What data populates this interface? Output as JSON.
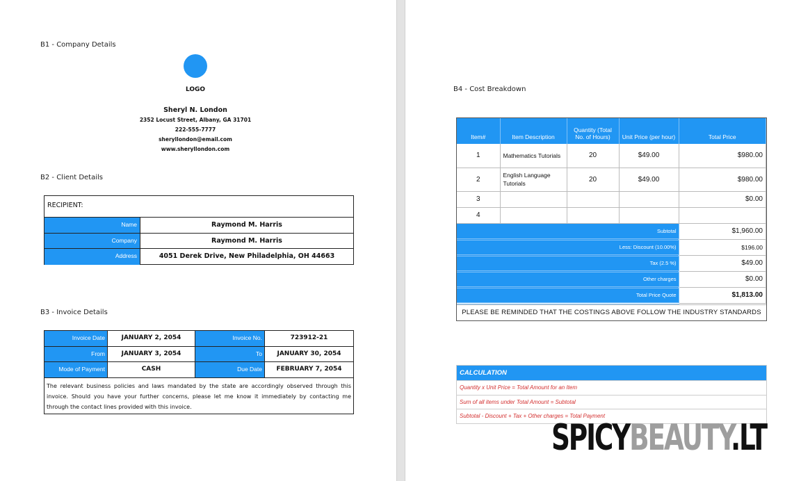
{
  "b1": {
    "section_label": "B1 - Company Details",
    "logo_text": "LOGO",
    "name": "Sheryl N. London",
    "address": "2352 Locust Street, Albany, GA 31701",
    "phone": "222-555-7777",
    "email": "sheryllondon@email.com",
    "website": "www.sheryllondon.com",
    "logo_color": "#2196f3"
  },
  "b2": {
    "section_label": "B2 - Client Details",
    "recipient_label": "RECIPIENT:",
    "rows": [
      {
        "label": "Name",
        "value": "Raymond M. Harris"
      },
      {
        "label": "Company",
        "value": "Raymond M. Harris"
      },
      {
        "label": "Address",
        "value": "4051 Derek Drive, New Philadelphia, OH 44663"
      }
    ]
  },
  "b3": {
    "section_label": "B3 - Invoice Details",
    "rows": [
      {
        "l1": "Invoice Date",
        "v1": "JANUARY 2, 2054",
        "l2": "Invoice No.",
        "v2": "723912-21"
      },
      {
        "l1": "From",
        "v1": "JANUARY 3, 2054",
        "l2": "To",
        "v2": "JANUARY 30, 2054"
      },
      {
        "l1": "Mode of Payment",
        "v1": "CASH",
        "l2": "Due Date",
        "v2": "FEBRUARY 7, 2054"
      }
    ],
    "note": "The relevant business policies and laws mandated by the state are accordingly observed through this invoice. Should you have your further concerns, please let me know it immediately by contacting me through the contact lines provided with this invoice."
  },
  "b4": {
    "section_label": "B4 - Cost Breakdown",
    "headers": [
      "Item#",
      "Item Description",
      "Quantity (Total No. of Hours)",
      "Unit Price (per hour)",
      "Total Price"
    ],
    "items": [
      {
        "num": "1",
        "desc": "Mathematics Tutorials",
        "qty": "20",
        "unit": "$49.00",
        "total": "$980.00"
      },
      {
        "num": "2",
        "desc": "English Language Tutorials",
        "qty": "20",
        "unit": "$49.00",
        "total": "$980.00"
      },
      {
        "num": "3",
        "desc": "",
        "qty": "",
        "unit": "",
        "total": "$0.00"
      },
      {
        "num": "4",
        "desc": "",
        "qty": "",
        "unit": "",
        "total": ""
      }
    ],
    "summary": [
      {
        "label": "Subtotal",
        "value": "$1,960.00"
      },
      {
        "label": "Less: Discount (10.00%)",
        "value": "$196.00"
      },
      {
        "label": "Tax (2.5 %)",
        "value": "$49.00"
      },
      {
        "label": "Other charges",
        "value": "$0.00"
      },
      {
        "label": "Total Price Quote",
        "value": "$1,813.00"
      }
    ],
    "notice": "PLEASE BE REMINDED THAT THE COSTINGS ABOVE FOLLOW THE INDUSTRY STANDARDS"
  },
  "calculation": {
    "title": "CALCULATION",
    "rows": [
      "Quantity x Unit Price = Total Amount for an Item",
      "Sum of all items under Total Amount = Subtotal",
      "Subtotal - Discount + Tax + Other charges = Total Payment"
    ],
    "text_color": "#d32f2f"
  },
  "watermark": {
    "part1": "SPICY",
    "part2": "BEAUTY",
    "part3": ".LT"
  },
  "colors": {
    "accent": "#2196f3",
    "gutter": "#e3e3e3"
  }
}
